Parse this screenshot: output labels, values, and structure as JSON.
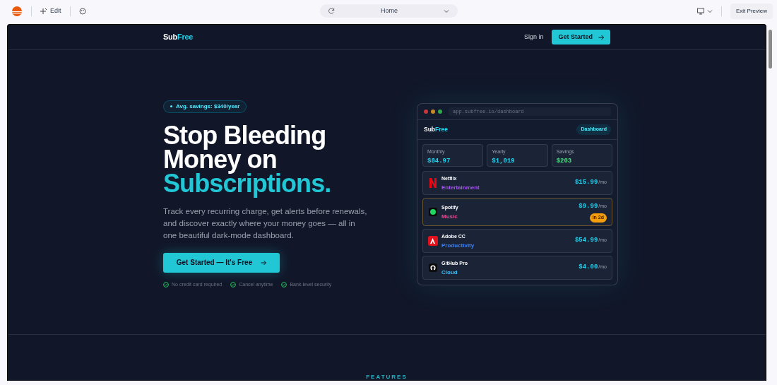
{
  "toolbar": {
    "edit_label": "Edit",
    "page_select": "Home",
    "exit_label": "Exit Preview"
  },
  "nav": {
    "logo_a": "Sub",
    "logo_b": "Free",
    "sign_in": "Sign in",
    "cta": "Get Started"
  },
  "hero": {
    "badge": "Avg. savings: $340/year",
    "title_line1": "Stop Bleeding",
    "title_line2": "Money on",
    "title_accent": "Subscriptions.",
    "description": "Track every recurring charge, get alerts before renewals, and discover exactly where your money goes — all in one beautiful dark-mode dashboard.",
    "cta": "Get Started — It's Free",
    "perks": [
      "No credit card required",
      "Cancel anytime",
      "Bank-level security"
    ]
  },
  "mockup": {
    "url": "app.subfree.io/dashboard",
    "logo_a": "Sub",
    "logo_b": "Free",
    "tab": "Dashboard",
    "stats": [
      {
        "label": "Monthly",
        "value": "$84.97",
        "color": "#22d3ee"
      },
      {
        "label": "Yearly",
        "value": "$1,019",
        "color": "#22d3ee"
      },
      {
        "label": "Savings",
        "value": "$203",
        "color": "#4ade80"
      }
    ],
    "subscriptions": [
      {
        "kind": "netflix",
        "name": "Netflix",
        "category": "Entertainment",
        "color": "#a855f7",
        "price": "$15.99",
        "period": "/mo",
        "due_soon": false
      },
      {
        "kind": "spotify",
        "name": "Spotify",
        "category": "Music",
        "color": "#ec4899",
        "price": "$9.99",
        "period": "/mo",
        "due_soon": true,
        "badge": "in 2d"
      },
      {
        "kind": "adobe",
        "name": "Adobe CC",
        "category": "Productivity",
        "color": "#3b82f6",
        "price": "$54.99",
        "period": "/mo",
        "due_soon": false
      },
      {
        "kind": "github",
        "name": "GitHub Pro",
        "category": "Cloud",
        "color": "#38bdf8",
        "price": "$4.00",
        "period": "/mo",
        "due_soon": false
      }
    ]
  },
  "features_label": "FEATURES"
}
